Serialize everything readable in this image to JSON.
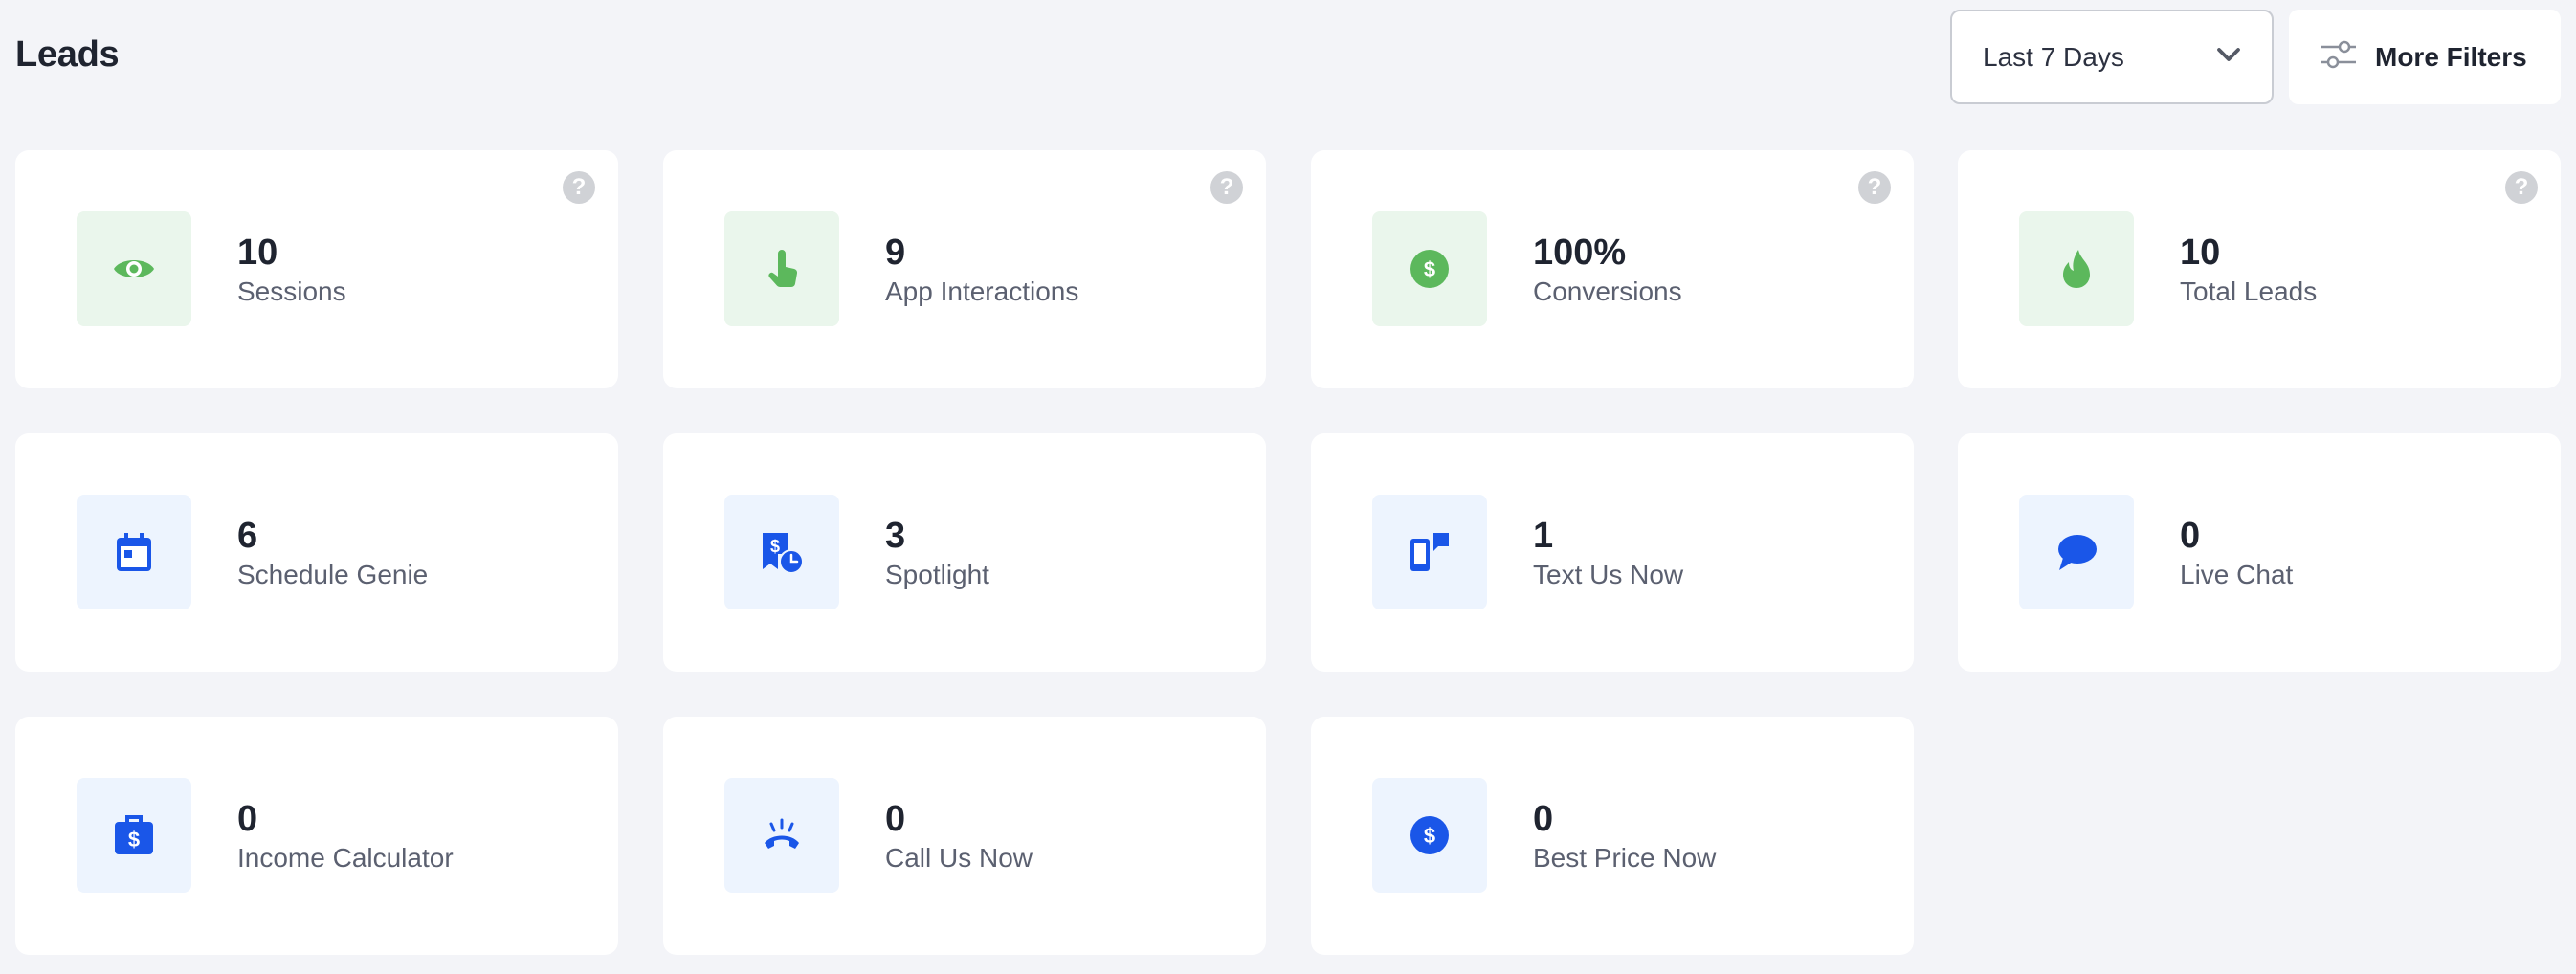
{
  "header": {
    "title": "Leads",
    "date_range": {
      "selected": "Last 7 Days",
      "icon": "chevron-down-icon"
    },
    "more_filters": {
      "label": "More Filters",
      "icon": "sliders-icon"
    },
    "help_glyph": "?"
  },
  "colors": {
    "green_accent": "#5cb85c",
    "green_tile": "#eaf6ec",
    "blue_accent": "#1a56e8",
    "blue_tile": "#edf4fe"
  },
  "cards": [
    {
      "value": "10",
      "label": "Sessions",
      "icon": "eye-icon",
      "tone": "green",
      "help": true
    },
    {
      "value": "9",
      "label": "App Interactions",
      "icon": "tap-icon",
      "tone": "green",
      "help": true
    },
    {
      "value": "100%",
      "label": "Conversions",
      "icon": "dollar-circle-icon",
      "tone": "green",
      "help": true
    },
    {
      "value": "10",
      "label": "Total Leads",
      "icon": "flame-icon",
      "tone": "green",
      "help": true
    },
    {
      "value": "6",
      "label": "Schedule Genie",
      "icon": "calendar-icon",
      "tone": "blue",
      "help": false
    },
    {
      "value": "3",
      "label": "Spotlight",
      "icon": "price-tag-clock-icon",
      "tone": "blue",
      "help": false
    },
    {
      "value": "1",
      "label": "Text Us Now",
      "icon": "phone-message-icon",
      "tone": "blue",
      "help": false
    },
    {
      "value": "0",
      "label": "Live Chat",
      "icon": "chat-bubble-icon",
      "tone": "blue",
      "help": false
    },
    {
      "value": "0",
      "label": "Income Calculator",
      "icon": "briefcase-dollar-icon",
      "tone": "blue",
      "help": false
    },
    {
      "value": "0",
      "label": "Call Us Now",
      "icon": "ringing-phone-icon",
      "tone": "blue",
      "help": false
    },
    {
      "value": "0",
      "label": "Best Price Now",
      "icon": "dollar-badge-icon",
      "tone": "blue",
      "help": false
    }
  ]
}
